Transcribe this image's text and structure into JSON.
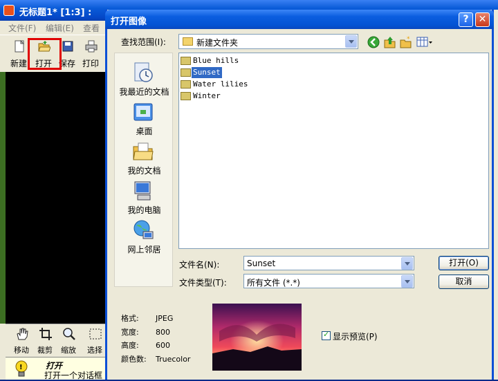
{
  "app": {
    "title": "无标题1* [1:3] :",
    "menus": [
      "文件(F)",
      "编辑(E)",
      "查看"
    ],
    "toolbar": [
      {
        "label": "新建",
        "icon": "new-file-icon"
      },
      {
        "label": "打开",
        "icon": "open-folder-icon"
      },
      {
        "label": "保存",
        "icon": "save-icon"
      },
      {
        "label": "打印",
        "icon": "print-icon"
      }
    ],
    "tools": [
      {
        "label": "移动",
        "icon": "hand-icon"
      },
      {
        "label": "裁剪",
        "icon": "crop-icon"
      },
      {
        "label": "缩放",
        "icon": "zoom-icon"
      },
      {
        "label": "选择",
        "icon": "select-icon"
      }
    ],
    "status": {
      "title": "打开",
      "description": "打开一个对话框"
    },
    "highlight_color": "#e00000"
  },
  "dialog": {
    "title": "打开图像",
    "help_glyph": "?",
    "close_glyph": "✕",
    "look_in_label": "查找范围(I):",
    "look_in_value": "新建文件夹",
    "places": [
      {
        "label": "我最近的文档",
        "icon": "recent-documents-icon"
      },
      {
        "label": "桌面",
        "icon": "desktop-icon"
      },
      {
        "label": "我的文档",
        "icon": "my-documents-icon"
      },
      {
        "label": "我的电脑",
        "icon": "my-computer-icon"
      },
      {
        "label": "网上邻居",
        "icon": "network-places-icon"
      }
    ],
    "files": [
      {
        "name": "Blue hills",
        "selected": false
      },
      {
        "name": "Sunset",
        "selected": true
      },
      {
        "name": "Water lilies",
        "selected": false
      },
      {
        "name": "Winter",
        "selected": false
      }
    ],
    "file_name_label": "文件名(N):",
    "file_name_value": "Sunset",
    "file_type_label": "文件类型(T):",
    "file_type_value": "所有文件 (*.*)",
    "open_button": "打开(O)",
    "cancel_button": "取消",
    "info": {
      "format_label": "格式:",
      "format_value": "JPEG",
      "width_label": "宽度:",
      "width_value": "800",
      "height_label": "高度:",
      "height_value": "600",
      "colors_label": "颜色数:",
      "colors_value": "Truecolor"
    },
    "preview_checkbox_label": "显示预览(P)",
    "preview_checked": true
  }
}
